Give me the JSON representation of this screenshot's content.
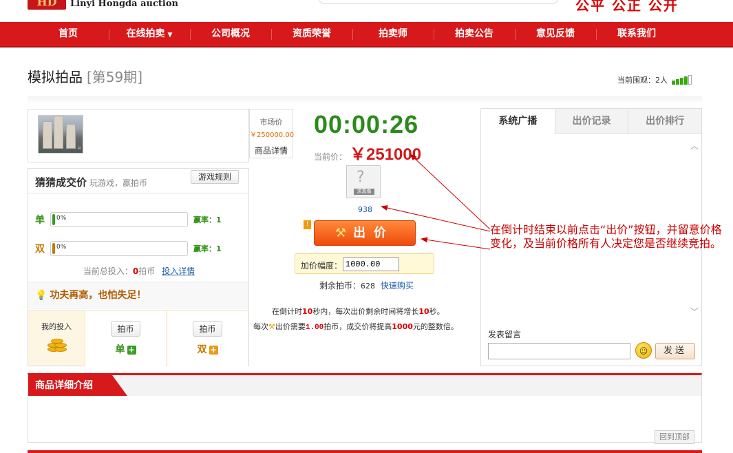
{
  "header": {
    "logo_text": "HD",
    "site_name": "Linyi Hongda auction",
    "slogan": "公平 公正 公开"
  },
  "nav": {
    "items": [
      "首页",
      "在线拍卖",
      "公司概况",
      "资质荣誉",
      "拍卖师",
      "拍卖公告",
      "意见反馈",
      "联系我们"
    ]
  },
  "page": {
    "title": "模拟拍品",
    "issue": "[第59期]",
    "viewers_label": "当前围观：",
    "viewers_count": "2人"
  },
  "product": {
    "market_price_label": "市场价",
    "market_price": "￥250000.00",
    "detail_button": "商品详情"
  },
  "guess": {
    "title": "猜猜成交价",
    "subtitle": "玩游戏，赢拍币",
    "rules_button": "游戏规则",
    "odd_label": "单",
    "even_label": "双",
    "odd_pct": "0%",
    "even_pct": "0%",
    "odd_pct_value": 0,
    "even_pct_value": 0,
    "win_rate_odd": "赢率：1",
    "win_rate_even": "赢率：1",
    "total_label": "当前总投入：",
    "total_value": "0",
    "total_unit": "拍币",
    "total_link": "投入详情",
    "tip": "功夫再高，也怕失足！",
    "my_invest": "我的投入",
    "coin_button": "拍币",
    "odd_button_label": "单",
    "even_button_label": "双"
  },
  "auction": {
    "countdown": "00:00:26",
    "current_price_label": "当前价：",
    "current_price": "￥251000",
    "avatar_tag": "求真像",
    "bidder_id": "938",
    "bid_button": "出价",
    "raise_label": "加价幅度：",
    "raise_value": "1000.00",
    "remain_label": "剩余拍币：",
    "remain_value": "628",
    "buy_link": "快速购买",
    "rule1_a": "在倒计时",
    "rule1_b": "10",
    "rule1_c": "秒内，每次出价剩余时间将增长",
    "rule1_d": "10",
    "rule1_e": "秒。",
    "rule2_a": "每次",
    "rule2_b": "出价需要",
    "rule2_c": "1.00",
    "rule2_d": "拍币，成交价将提高",
    "rule2_e": "1000",
    "rule2_f": "元的整数倍。"
  },
  "right_panel": {
    "tabs": [
      "系统广播",
      "出价记录",
      "出价排行"
    ],
    "comment_title": "发表留言",
    "send_button": "发送"
  },
  "annotation": {
    "text": "在倒计时结束以前点击“出价”按钮，并留意价格变化，及当前价格所有人决定您是否继续竞拍。"
  },
  "details": {
    "tab_title": "商品详细介绍",
    "back_top": "回到顶部"
  },
  "colors": {
    "brand_red": "#d7191b",
    "countdown_green": "#2b8a1a",
    "price_red": "#d21a1a",
    "bid_orange": "#ef4b0c"
  }
}
